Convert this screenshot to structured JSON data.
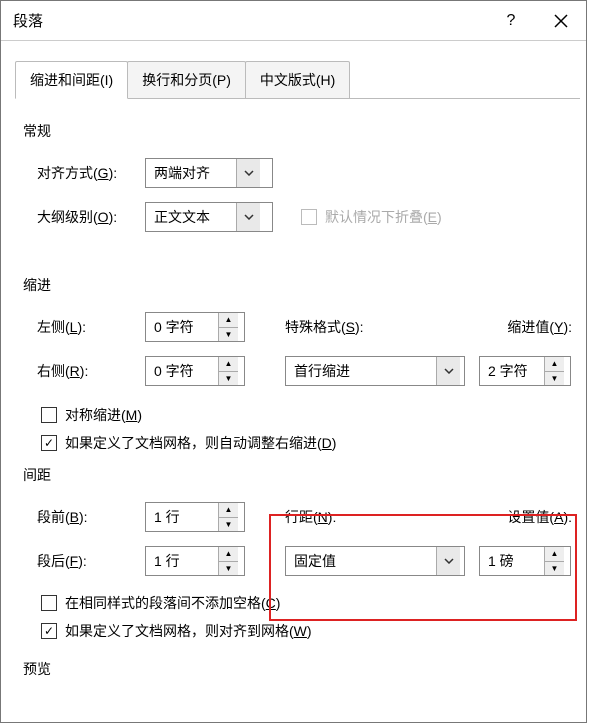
{
  "window": {
    "title": "段落",
    "help": "?",
    "close": "×"
  },
  "tabs": {
    "t0": "缩进和间距(I)",
    "t1": "换行和分页(P)",
    "t2": "中文版式(H)"
  },
  "sections": {
    "general": "常规",
    "indent": "缩进",
    "spacing": "间距",
    "preview": "预览"
  },
  "labels": {
    "align": "对齐方式(G):",
    "outline": "大纲级别(O):",
    "left": "左侧(L):",
    "right": "右侧(R):",
    "special": "特殊格式(S):",
    "by": "缩进值(Y):",
    "before": "段前(B):",
    "after": "段后(F):",
    "linespacing": "行距(N):",
    "at": "设置值(A):",
    "collapsed": "默认情况下折叠(E)",
    "mirror": "对称缩进(M)",
    "grid_indent": "如果定义了文档网格，则自动调整右缩进(D)",
    "nospace": "在相同样式的段落间不添加空格(C)",
    "grid_spacing": "如果定义了文档网格，则对齐到网格(W)"
  },
  "values": {
    "align": "两端对齐",
    "outline": "正文文本",
    "left": "0 字符",
    "right": "0 字符",
    "special": "首行缩进",
    "by": "2 字符",
    "before": "1 行",
    "after": "1 行",
    "linespacing": "固定值",
    "at": "1 磅"
  },
  "checks": {
    "collapsed": false,
    "mirror": false,
    "grid_indent": true,
    "nospace": false,
    "grid_spacing": true
  },
  "chart_data": null
}
